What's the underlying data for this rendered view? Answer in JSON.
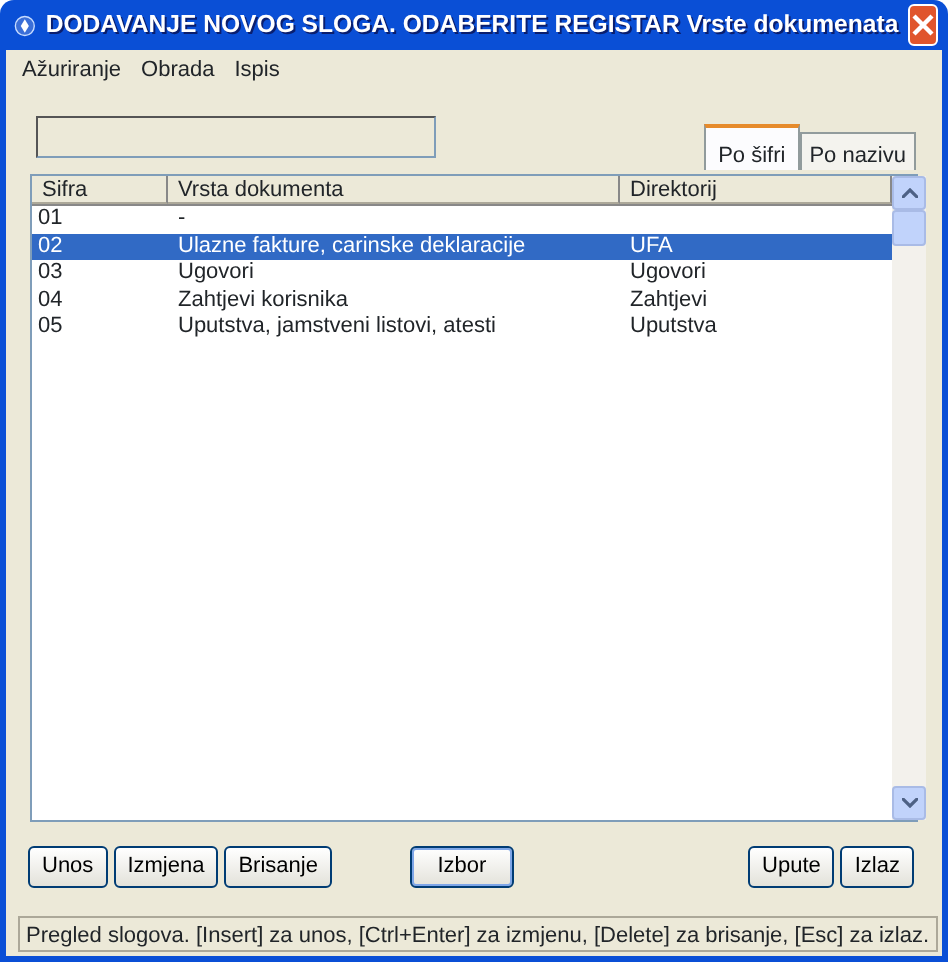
{
  "window": {
    "title": "DODAVANJE NOVOG SLOGA. ODABERITE REGISTAR Vrste dokumenata"
  },
  "menu": [
    "Ažuriranje",
    "Obrada",
    "Ispis"
  ],
  "tabs": [
    {
      "label": "Po šifri",
      "selected": true
    },
    {
      "label": "Po nazivu",
      "selected": false
    }
  ],
  "table": {
    "columns": [
      "Sifra",
      "Vrsta dokumenta",
      "Direktorij"
    ],
    "rows": [
      {
        "cells": [
          "01",
          "-",
          ""
        ],
        "selected": false
      },
      {
        "cells": [
          "02",
          "Ulazne fakture, carinske deklaracije",
          "UFA"
        ],
        "selected": true
      },
      {
        "cells": [
          "03",
          "Ugovori",
          "Ugovori"
        ],
        "selected": false
      },
      {
        "cells": [
          "04",
          "Zahtjevi korisnika",
          "Zahtjevi"
        ],
        "selected": false
      },
      {
        "cells": [
          "05",
          "Uputstva, jamstveni listovi, atesti",
          "Uputstva"
        ],
        "selected": false
      }
    ]
  },
  "button_groups": [
    [
      {
        "label": "Unos",
        "default": false
      },
      {
        "label": "Izmjena",
        "default": false
      },
      {
        "label": "Brisanje",
        "default": false
      }
    ],
    [
      {
        "label": "Izbor",
        "default": true
      }
    ],
    [
      {
        "label": "Upute",
        "default": false
      },
      {
        "label": "Izlaz",
        "default": false
      }
    ]
  ],
  "status_bar": "Pregled slogova. [Insert] za unos, [Ctrl+Enter] za izmjenu, [Delete] za brisanje, [Esc] za izlaz."
}
